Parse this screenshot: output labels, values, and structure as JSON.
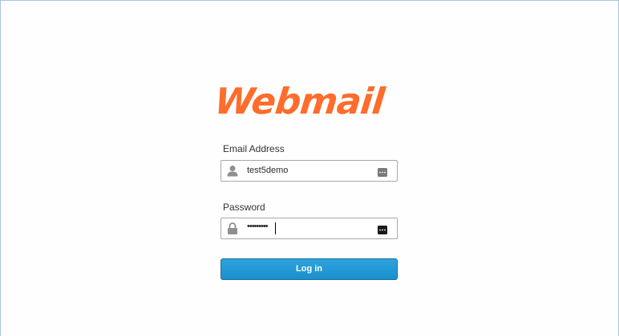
{
  "logo": {
    "text": "Webmail",
    "color": "#ff6c2c"
  },
  "form": {
    "email": {
      "label": "Email Address",
      "value": "test5demo",
      "icon": "user-icon",
      "trailing_icon": "credentials-icon"
    },
    "password": {
      "label": "Password",
      "masked_value": "•••••••••",
      "icon": "lock-icon",
      "trailing_icon": "credentials-icon"
    },
    "login_button": {
      "label": "Log in",
      "color": "#1f93d0"
    }
  }
}
